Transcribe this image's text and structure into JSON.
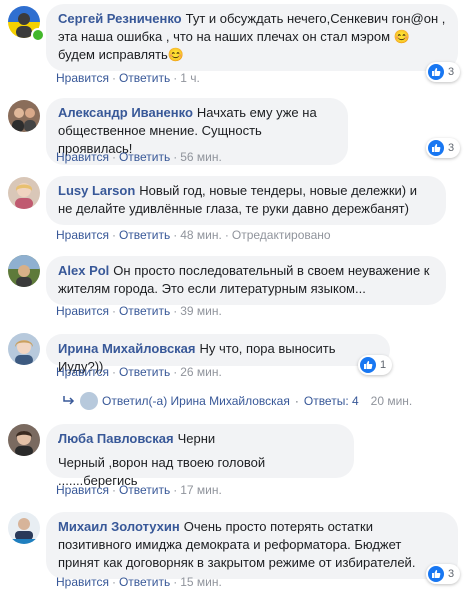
{
  "colors": {
    "link": "#385898",
    "bubble": "#f2f3f5",
    "like": "#1877f2",
    "online": "#42b72a"
  },
  "comments": [
    {
      "author": "Сергей Резниченко",
      "text": "Тут и обсуждать нечего,Сенкевич гон@он , эта наша ошибка , что на наших плечах он стал мэром 😊 будем исправлять😊",
      "like": "Нравится",
      "reply": "Ответить",
      "time": "1 ч.",
      "reactions": "3",
      "reaction_icon": "thumbs-up-icon"
    },
    {
      "author": "Александр Иваненко",
      "text": "Начхать ему уже на общественное мнение. Сущность проявилась!",
      "like": "Нравится",
      "reply": "Ответить",
      "time": "56 мин.",
      "reactions": "3",
      "reaction_icon": "thumbs-up-icon"
    },
    {
      "author": "Lusy Larson",
      "text": "Новый год, новые тендеры, новые дележки) и не делайте удивлённые глаза, те руки давно дережбанят)",
      "like": "Нравится",
      "reply": "Ответить",
      "time": "48 мин.",
      "edited": "Отредактировано"
    },
    {
      "author": "Alex Pol",
      "text": "Он просто последовательный в своем неуважение к жителям города. Это если литературным языком...",
      "like": "Нравится",
      "reply": "Ответить",
      "time": "39 мин."
    },
    {
      "author": "Ирина Михайловская",
      "text": "Ну что, пора выносить Иуду?))",
      "like": "Нравится",
      "reply": "Ответить",
      "time": "26 мин.",
      "reactions": "1",
      "reaction_icon": "thumbs-up-icon",
      "replies_summary": {
        "replied_by": "Ответил(-а) Ирина Михайловская",
        "count": "Ответы: 4",
        "time": "20 мин."
      }
    },
    {
      "author": "Люба Павловская",
      "text_line1": "Черни",
      "text_line2": "Черный ,ворон над твоею головой .......берегись",
      "like": "Нравится",
      "reply": "Ответить",
      "time": "17 мин."
    },
    {
      "author": "Михаил Золотухин",
      "text": "Очень просто потерять остатки позитивного имиджа демократа и реформатора. Бюджет принят как договорняк в закрытом режиме от избирателей.",
      "like": "Нравится",
      "reply": "Ответить",
      "time": "15 мин.",
      "reactions": "3",
      "reaction_icon": "thumbs-up-icon"
    }
  ],
  "separator": "·"
}
